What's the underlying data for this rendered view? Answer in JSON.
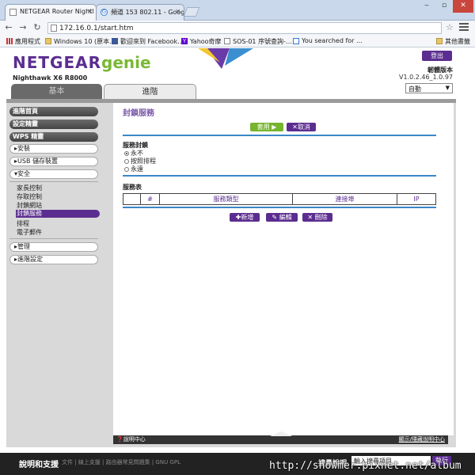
{
  "browser": {
    "tabs": [
      {
        "label": "NETGEAR Router Nightl"
      },
      {
        "label": "頻道 153 802.11 - Googl"
      }
    ],
    "url": "172.16.0.1/start.htm",
    "bookmarks": [
      {
        "label": "應用程式",
        "icon": "apps-icon"
      },
      {
        "label": "Windows 10 (原本…",
        "icon": "folder-icon"
      },
      {
        "label": "歡迎來到 Facebook…",
        "icon": "facebook-icon"
      },
      {
        "label": "Yahoo奇摩",
        "icon": "yahoo-icon"
      },
      {
        "label": "SOS-01 序號查詢-…",
        "icon": "page-icon"
      },
      {
        "label": "You searched for …",
        "icon": "google-icon"
      },
      {
        "label": "其他書籤",
        "icon": "folder-icon"
      }
    ]
  },
  "header": {
    "logo_main": "NETGEAR",
    "logo_genie": "genie",
    "model": "Nighthawk X6 R8000",
    "logout": "登出",
    "fw_label": "韌體版本",
    "fw_version": "V1.0.2.46_1.0.97",
    "language": "自動"
  },
  "tabs": {
    "basic": "基本",
    "advanced": "進階"
  },
  "sidebar": {
    "home": "進階首頁",
    "setup": "設定精靈",
    "wps": "WPS 精靈",
    "setup_menu": "▸安裝",
    "usb": "▸USB 儲存裝置",
    "security": "▾安全",
    "security_items": [
      "家長控制",
      "存取控制",
      "封鎖網站",
      "封鎖服務",
      "排程",
      "電子郵件"
    ],
    "admin": "▸管理",
    "advanced_setup": "▸進階設定"
  },
  "content": {
    "title": "封鎖服務",
    "apply": "套用 ▶",
    "cancel": "✕取消",
    "block_label": "服務封鎖",
    "options": [
      "永不",
      "按照排程",
      "永遠"
    ],
    "table_label": "服務表",
    "columns": [
      "#",
      "服務類型",
      "連接埠",
      "IP"
    ],
    "add": "✚新增",
    "edit": "✎ 編輯",
    "delete": "✕ 刪除"
  },
  "helpbar": {
    "help_center": "❓說明中心",
    "show_hide": "顯示/隱藏說明中心"
  },
  "footer": {
    "title": "說明和支援",
    "links": "文件 | 線上支援 | 路由器常見問題集 | GNU GPL",
    "search_label": "搜尋說明",
    "search_placeholder": "輸入搜尋項目",
    "search_btn": "執行"
  },
  "watermark": "http://showmer.pixnet.net/album",
  "colors": {
    "brand_purple": "#5b2d90",
    "genie_green": "#7ab833",
    "apply_green": "#76b52e",
    "line_blue": "#3a87c8"
  }
}
